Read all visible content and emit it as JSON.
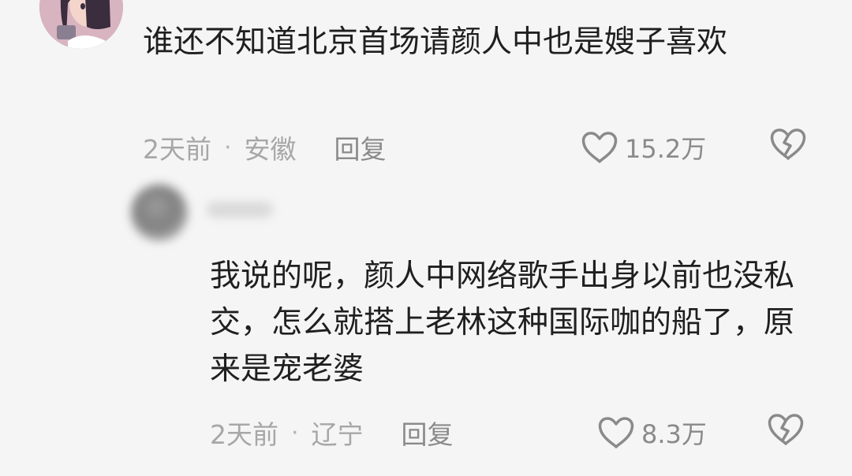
{
  "comments": [
    {
      "text": "谁还不知道北京首场请颜人中也是嫂子喜欢",
      "time": "2天前",
      "separator": "·",
      "location": "安徽",
      "reply_label": "回复",
      "likes": "15.2万"
    },
    {
      "text": "我说的呢，颜人中网络歌手出身以前也没私交，怎么就搭上老林这种国际咖的船了，原来是宠老婆",
      "time": "2天前",
      "separator": "·",
      "location": "辽宁",
      "reply_label": "回复",
      "likes": "8.3万"
    }
  ],
  "icons": {
    "like": "heart-outline-icon",
    "dislike": "broken-heart-icon"
  },
  "colors": {
    "background": "#f5f5f5",
    "text": "#1f1f1f",
    "meta": "#a7a7a7",
    "action": "#8a8a8a"
  }
}
